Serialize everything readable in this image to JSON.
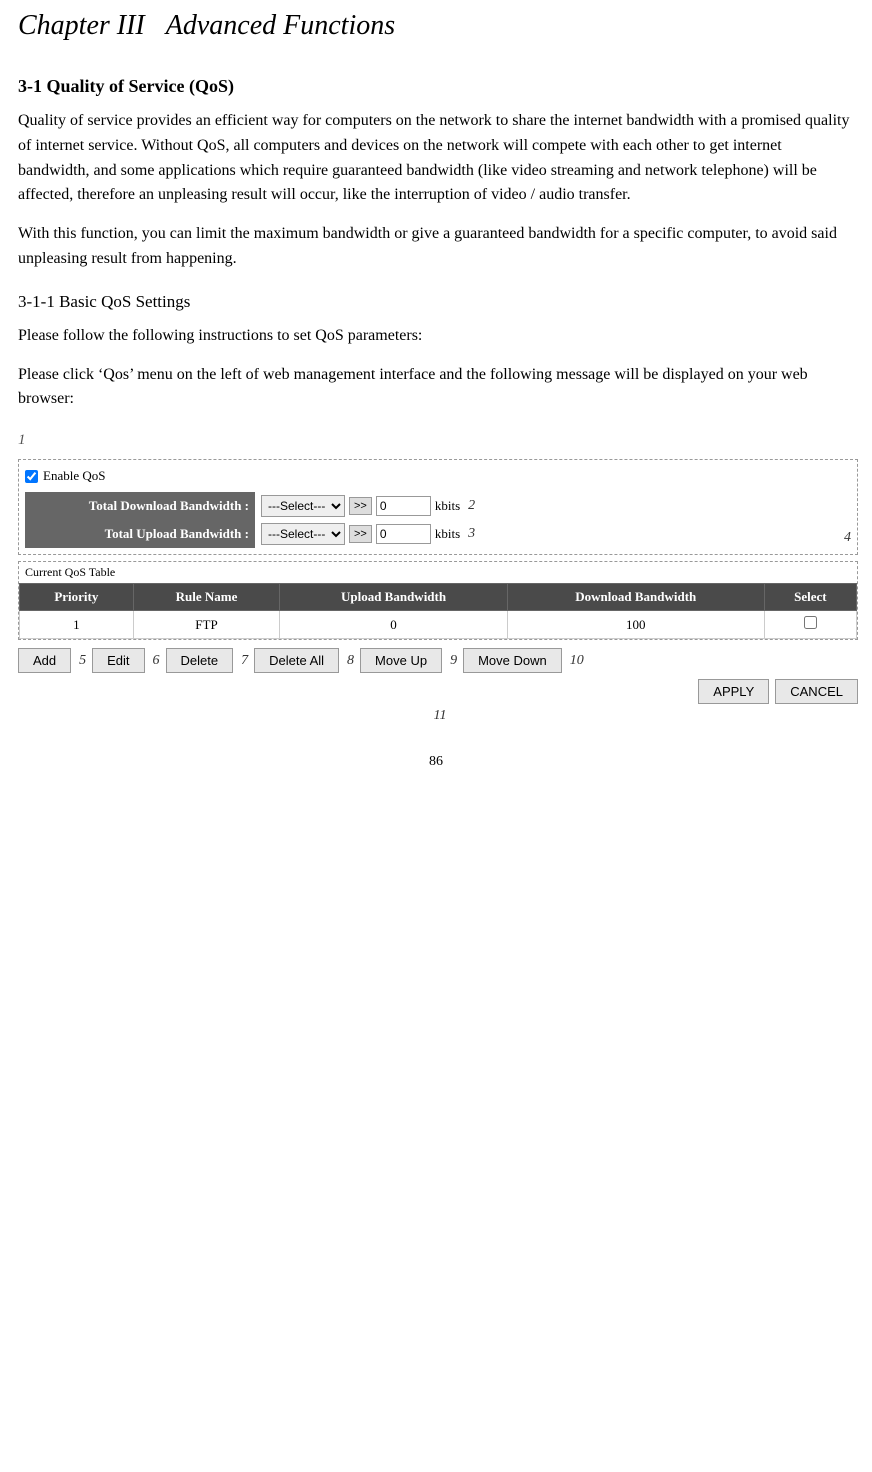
{
  "title": {
    "chapter": "Chapter III",
    "subtitle": "Advanced Functions"
  },
  "sections": {
    "main_heading": "3-1 Quality of Service (QoS)",
    "paragraph1": "Quality of service provides an efficient way for computers on the network to share the internet bandwidth with a promised quality of internet service. Without QoS, all computers and devices on the network will compete with each other to get internet bandwidth, and some applications which require guaranteed bandwidth (like video streaming and network telephone) will be affected, therefore an unpleasing result will occur, like the interruption of video / audio transfer.",
    "paragraph2": "With this function, you can limit the maximum bandwidth or give a guaranteed bandwidth for a specific computer, to avoid said unpleasing result from happening.",
    "sub_heading": "3-1-1 Basic QoS Settings",
    "paragraph3": "Please follow the following instructions to set QoS parameters:",
    "paragraph4": "Please click ‘Qos’ menu on the left of web management interface and the following message will be displayed on your web browser:"
  },
  "diagram": {
    "callout1": "1",
    "enable_checkbox_label": "Enable QoS",
    "callout2": "2",
    "callout3": "3",
    "callout4": "4",
    "total_download_label": "Total Download Bandwidth :",
    "total_upload_label": "Total Upload Bandwidth :",
    "select_placeholder": "---Select---",
    "arrow_btn": ">>",
    "download_value": "0",
    "upload_value": "0",
    "kbits": "kbits",
    "current_qos_title": "Current QoS Table",
    "table_headers": [
      "Priority",
      "Rule Name",
      "Upload Bandwidth",
      "Download Bandwidth",
      "Select"
    ],
    "table_rows": [
      {
        "priority": "1",
        "rule_name": "FTP",
        "upload_bw": "0",
        "download_bw": "100",
        "select": ""
      }
    ],
    "buttons": {
      "add": "Add",
      "edit": "Edit",
      "delete": "Delete",
      "delete_all": "Delete All",
      "move_up": "Move Up",
      "move_down": "Move Down",
      "apply": "APPLY",
      "cancel": "CANCEL"
    },
    "callout5": "5",
    "callout6": "6",
    "callout7": "7",
    "callout8": "8",
    "callout9": "9",
    "callout10": "10",
    "callout11": "11"
  },
  "page_number": "86"
}
